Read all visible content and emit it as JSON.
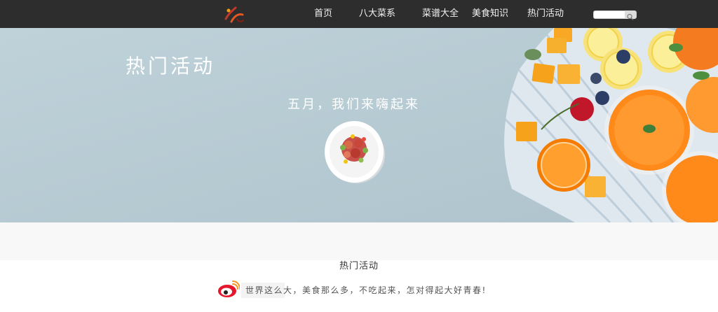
{
  "nav": {
    "items": [
      {
        "label": "首页"
      },
      {
        "label": "八大菜系"
      },
      {
        "label": "菜谱大全"
      },
      {
        "label": "美食知识"
      },
      {
        "label": "热门活动"
      }
    ],
    "search": {
      "placeholder": ""
    }
  },
  "banner": {
    "title": "热门活动",
    "subtitle": "五月，我们来嗨起来"
  },
  "section": {
    "title": "热门活动",
    "slogan": "世界这么大，美食那么多，不吃起来，怎对得起大好青春!"
  },
  "colors": {
    "nav_bg": "#2d2d2d",
    "banner_bg": "#b9cdd6",
    "accent_orange": "#f7941d",
    "weibo_red": "#e6162d"
  },
  "icons": {
    "logo": "logo-icon",
    "search": "search-icon",
    "weibo": "weibo-icon"
  }
}
